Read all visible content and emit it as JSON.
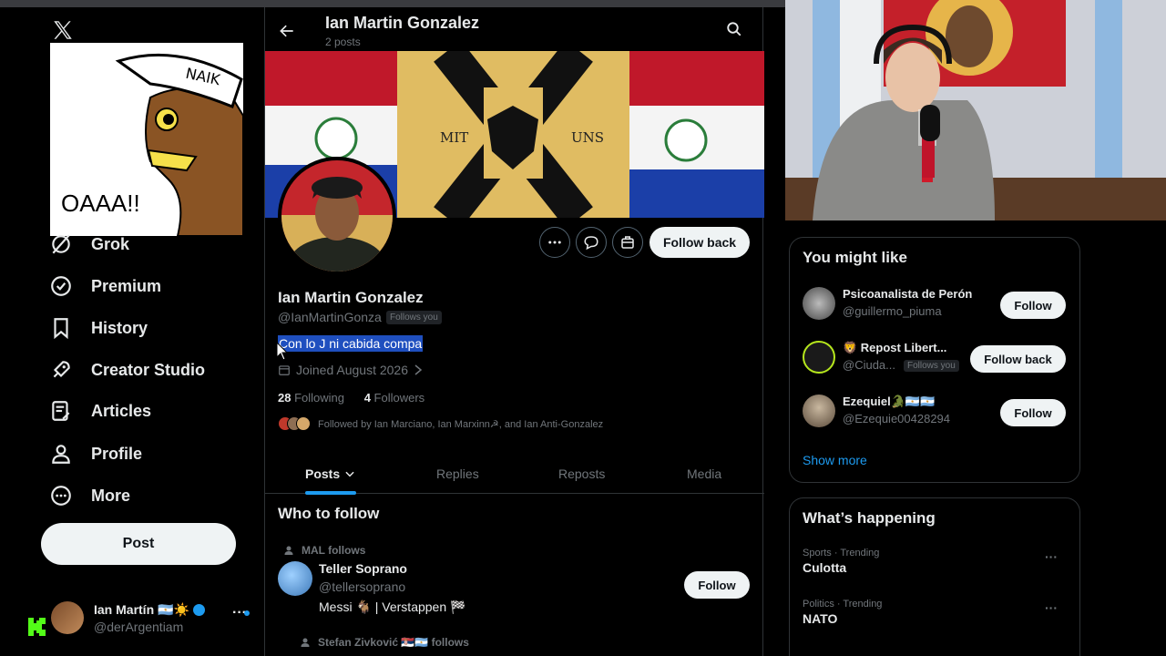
{
  "app": {
    "logo": "x-logo"
  },
  "meme": {
    "cap_text": "NAIK",
    "shout_text": "OAAA!!"
  },
  "nav": [
    {
      "label": "Grok",
      "icon": "grok-icon"
    },
    {
      "label": "Premium",
      "icon": "premium-icon"
    },
    {
      "label": "History",
      "icon": "bookmark-icon"
    },
    {
      "label": "Creator Studio",
      "icon": "rocket-icon"
    },
    {
      "label": "Articles",
      "icon": "articles-icon"
    },
    {
      "label": "Profile",
      "icon": "person-icon"
    },
    {
      "label": "More",
      "icon": "more-circle-icon"
    }
  ],
  "post_button": "Post",
  "account": {
    "name": "Ian Martín 🇦🇷☀️",
    "handle": "@derArgentiam",
    "more": "···"
  },
  "header": {
    "title": "Ian Martin Gonzalez",
    "subtitle": "2 posts"
  },
  "banner": {
    "left_text": "MIT",
    "right_text": "UNS"
  },
  "profile": {
    "name": "Ian Martin Gonzalez",
    "handle": "@IanMartinGonza",
    "follows_you": "Follows you",
    "bio": "Con lo J ni cabida compa",
    "joined": "Joined August 2026",
    "following_count": "28",
    "following_label": "Following",
    "followers_count": "4",
    "followers_label": "Followers",
    "followed_by": "Followed by Ian Marciano, Ian Marxinn☭, and Ian Anti-Gonzalez",
    "follow_back": "Follow back"
  },
  "tabs": [
    {
      "label": "Posts",
      "active": true
    },
    {
      "label": "Replies",
      "active": false
    },
    {
      "label": "Reposts",
      "active": false
    },
    {
      "label": "Media",
      "active": false
    }
  ],
  "who_to_follow": {
    "title": "Who to follow",
    "items": [
      {
        "meta": "MAL follows",
        "name": "Teller Soprano",
        "handle": "@tellersoprano",
        "bio": "Messi 🐐 | Verstappen 🏁",
        "button": "Follow"
      },
      {
        "meta": "Stefan Zivković 🇷🇸🇦🇷 follows"
      }
    ]
  },
  "you_might_like": {
    "title": "You might like",
    "items": [
      {
        "name": "Psicoanalista de Perón",
        "handle": "@guillermo_piuma",
        "button": "Follow"
      },
      {
        "name": "🦁 Repost Libert...",
        "handle": "@Ciuda...",
        "follows_you": "Follows you",
        "button": "Follow back"
      },
      {
        "name": "Ezequiel🐊🇦🇷🇦🇷",
        "handle": "@Ezequie00428294",
        "button": "Follow"
      }
    ],
    "show_more": "Show more"
  },
  "whats_happening": {
    "title": "What’s happening",
    "trends": [
      {
        "category": "Sports · Trending",
        "name": "Culotta"
      },
      {
        "category": "Politics · Trending",
        "name": "NATO"
      }
    ]
  },
  "colors": {
    "accent": "#1d9bf0",
    "background": "#000000",
    "border": "#2f3336",
    "muted": "#71767b"
  }
}
